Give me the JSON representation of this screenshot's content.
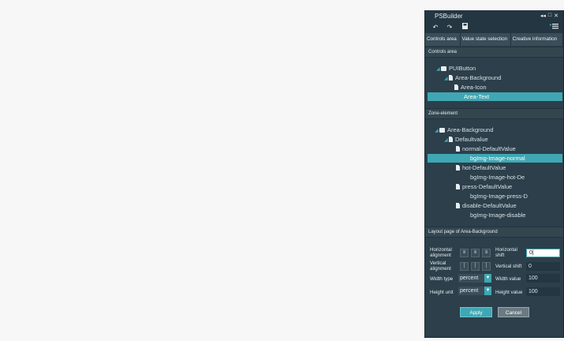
{
  "window": {
    "title": "PSBuilder",
    "controls": [
      "◂◂",
      "□",
      "✕"
    ]
  },
  "toolbar": {
    "icons": [
      "undo-icon",
      "redo-icon",
      "save-icon",
      "list-menu-icon"
    ]
  },
  "tabs": [
    {
      "label": "Controls area"
    },
    {
      "label": "Value state selection"
    },
    {
      "label": "Creative information"
    }
  ],
  "controls_area": {
    "header": "Controls area",
    "tree": [
      {
        "label": "PUIButton",
        "level": 0,
        "icon": "folder-icon",
        "expanded": true
      },
      {
        "label": "Area-Background",
        "level": 1,
        "icon": "file-icon",
        "expanded": true
      },
      {
        "label": "Area-Icon",
        "level": 2,
        "icon": "file-icon"
      },
      {
        "label": "Area-Text",
        "level": 2,
        "icon": "",
        "selected": true
      }
    ]
  },
  "zone_element": {
    "header": "Zone-element",
    "tree": [
      {
        "label": "Area-Background",
        "level": 0,
        "icon": "folder-icon",
        "expanded": true
      },
      {
        "label": "Defaultvalue",
        "level": 1,
        "icon": "file-icon",
        "expanded": true
      },
      {
        "label": "normal-DefaultValue",
        "level": 2,
        "icon": "file-icon"
      },
      {
        "label": "bgImg-Image-normal",
        "level": 3,
        "icon": "",
        "selected": true
      },
      {
        "label": "hot-DefaultValue",
        "level": 2,
        "icon": "file-icon"
      },
      {
        "label": "bgImg-Image-hot-De",
        "level": 3,
        "icon": ""
      },
      {
        "label": "press-DefaultValue",
        "level": 2,
        "icon": "file-icon"
      },
      {
        "label": "bgImg-Image-press-D",
        "level": 3,
        "icon": ""
      },
      {
        "label": "disable-DefaultValue",
        "level": 2,
        "icon": "file-icon"
      },
      {
        "label": "bgImg-Image-disable",
        "level": 3,
        "icon": ""
      }
    ]
  },
  "layout": {
    "header": "Layout page of Area-Background",
    "horizontal_alignment_label": "Horizontal alignment",
    "vertical_alignment_label": "Vertical alignment",
    "horizontal_shift_label": "Horizontal shift",
    "horizontal_shift_value": "0|",
    "vertical_shift_label": "Vertical shift",
    "vertical_shift_value": "0",
    "width_type_label": "Width type",
    "width_type_value": "percent",
    "width_value_label": "Width value",
    "width_value": "100",
    "height_unit_label": "Height unit",
    "height_unit_value": "percent",
    "height_value_label": "Height value",
    "height_value": "100"
  },
  "buttons": {
    "apply": "Apply",
    "cancel": "Cancel"
  },
  "colors": {
    "panel_bg": "#2c3f4b",
    "accent": "#3fa7b3"
  }
}
